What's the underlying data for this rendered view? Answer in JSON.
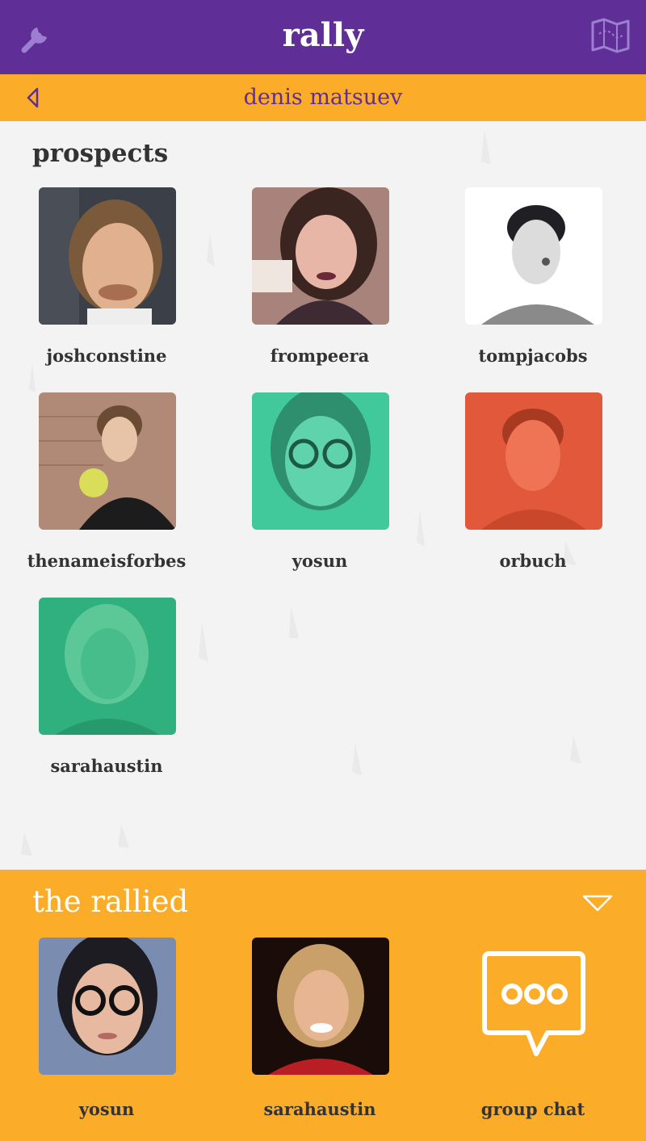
{
  "header": {
    "title": "rally",
    "left_icon": "wrench-icon",
    "right_icon": "map-icon",
    "color": "#5f2e96"
  },
  "subheader": {
    "title": "denis matsuev",
    "back_icon": "back-triangle-icon",
    "color": "#fbad2a"
  },
  "prospects": {
    "heading": "prospects",
    "items": [
      {
        "name": "joshconstine"
      },
      {
        "name": "frompeera"
      },
      {
        "name": "tompjacobs"
      },
      {
        "name": "thenameisforbes"
      },
      {
        "name": "yosun"
      },
      {
        "name": "orbuch"
      },
      {
        "name": "sarahaustin"
      }
    ]
  },
  "rallied": {
    "heading": "the rallied",
    "collapse_icon": "chevron-down-icon",
    "items": [
      {
        "name": "yosun"
      },
      {
        "name": "sarahaustin"
      },
      {
        "name": "group chat",
        "icon": "chat-bubble-icon"
      }
    ]
  }
}
